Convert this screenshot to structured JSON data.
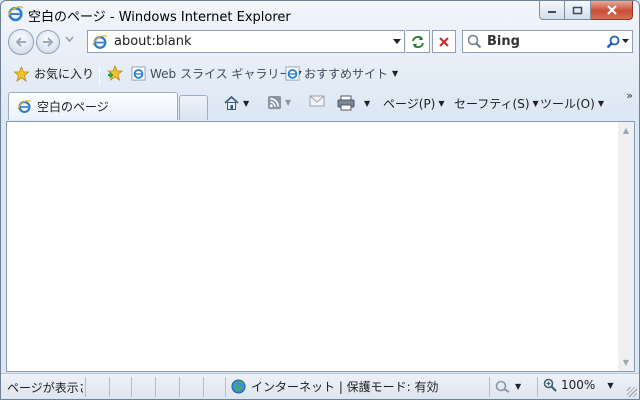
{
  "window": {
    "title": "空白のページ - Windows Internet Explorer"
  },
  "address_bar": {
    "url": "about:blank"
  },
  "search": {
    "value": "Bing"
  },
  "favorites_bar": {
    "favorites_label": "お気に入り",
    "web_slice_gallery": "Web スライス ギャラリー",
    "suggested_sites": "おすすめサイト"
  },
  "tab": {
    "label": "空白のページ"
  },
  "command_bar": {
    "page": "ページ(P)",
    "safety": "セーフティ(S)",
    "tools": "ツール(O)",
    "more": "»"
  },
  "status_bar": {
    "text": "ページが表示さ",
    "zone": "インターネット | 保護モード: 有効",
    "zoom": "100%"
  },
  "colors": {
    "accent": "#1e6fc8",
    "close_button": "#c94f35"
  },
  "icons": [
    "ie-logo-icon",
    "back-arrow-icon",
    "forward-arrow-icon",
    "refresh-icon",
    "stop-icon",
    "search-icon",
    "star-icon",
    "add-favorite-icon",
    "home-icon",
    "rss-icon",
    "mail-icon",
    "print-icon",
    "globe-icon",
    "zoom-icon"
  ]
}
